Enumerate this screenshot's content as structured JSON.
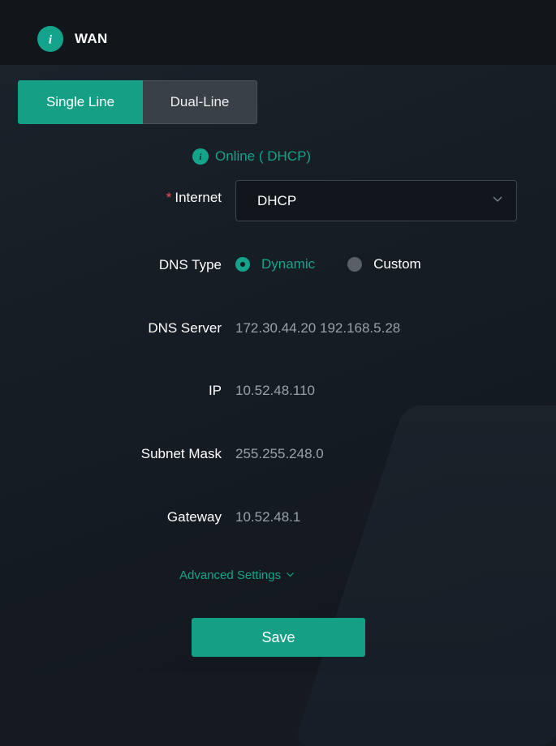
{
  "header": {
    "title": "WAN"
  },
  "tabs": [
    {
      "label": "Single Line",
      "active": true
    },
    {
      "label": "Dual-Line",
      "active": false
    }
  ],
  "status": {
    "text": "Online ( DHCP)"
  },
  "form": {
    "internet": {
      "label": "Internet",
      "required_mark": "*",
      "value": "DHCP"
    },
    "dns_type": {
      "label": "DNS Type",
      "options": [
        {
          "label": "Dynamic",
          "checked": true
        },
        {
          "label": "Custom",
          "checked": false
        }
      ]
    },
    "dns_server": {
      "label": "DNS Server",
      "value": "172.30.44.20 192.168.5.28"
    },
    "ip": {
      "label": "IP",
      "value": "10.52.48.110"
    },
    "subnet_mask": {
      "label": "Subnet Mask",
      "value": "255.255.248.0"
    },
    "gateway": {
      "label": "Gateway",
      "value": "10.52.48.1"
    }
  },
  "advanced_label": "Advanced Settings",
  "save_label": "Save",
  "colors": {
    "accent": "#14a38b",
    "background": "#141a20",
    "muted_text": "#9aa0a8",
    "required": "#ff4d4f"
  },
  "icons": [
    "info-icon",
    "chevron-down-icon"
  ]
}
